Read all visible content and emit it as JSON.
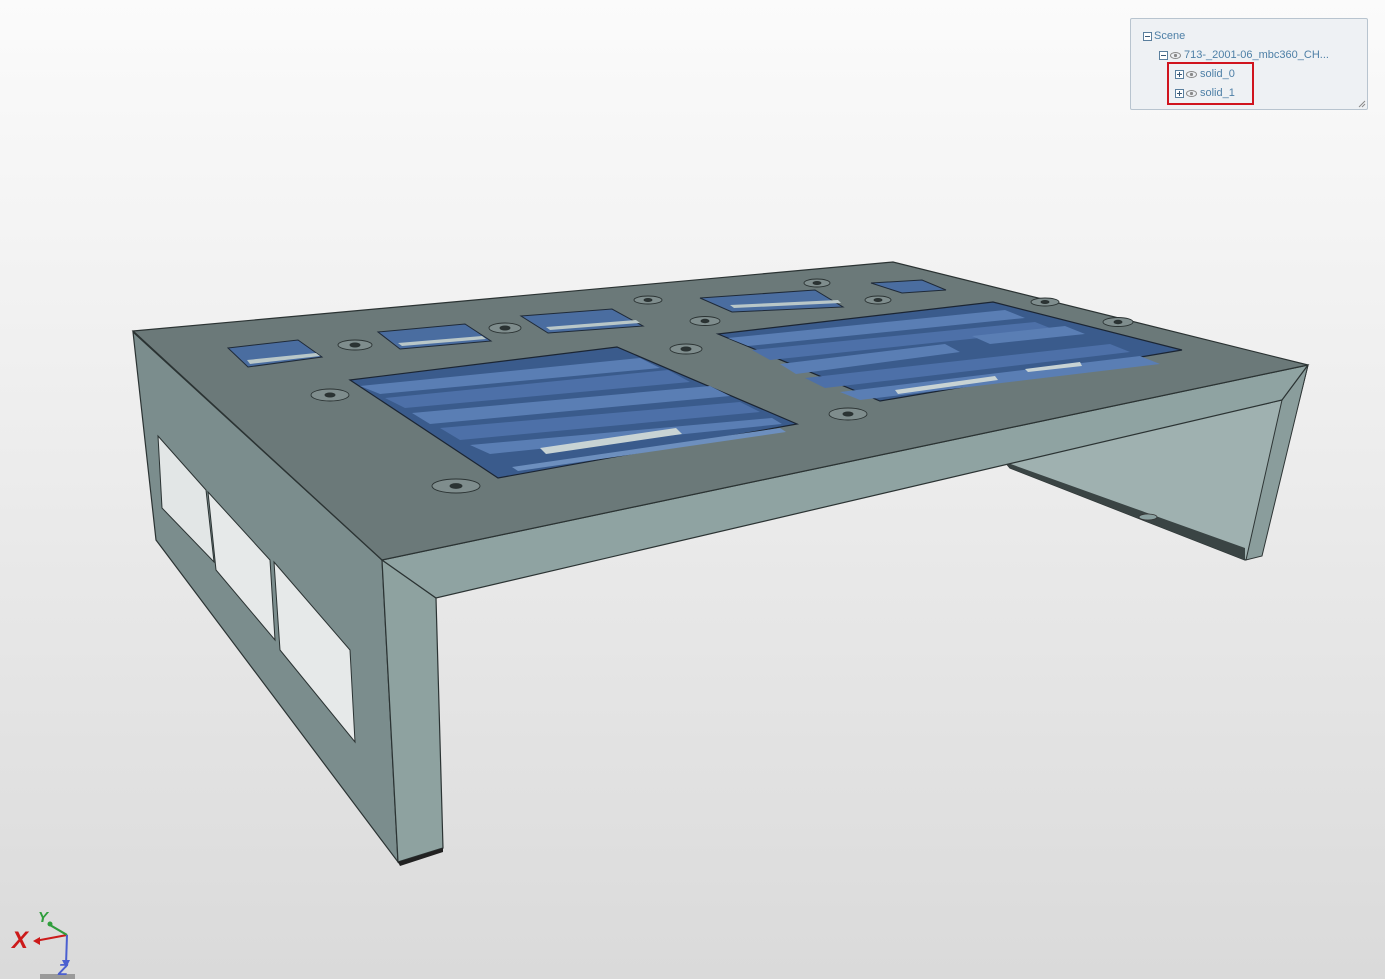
{
  "scene_tree": {
    "root_label": "Scene",
    "model_label": "713-_2001-06_mbc360_CH...",
    "children": [
      {
        "label": "solid_0"
      },
      {
        "label": "solid_1"
      }
    ]
  },
  "axes": {
    "x_label": "X",
    "y_label": "Y",
    "z_label": "Z",
    "x_color": "#cc1a1a",
    "y_color": "#2f9e3c",
    "z_color": "#4a5fd0"
  },
  "colors": {
    "plate_top": "#6a7778",
    "plate_side": "#8a9a9b",
    "leg_face": "#8ea2a0",
    "cutout_blue": "#3d5d8e",
    "highlight": "#d0141e"
  }
}
